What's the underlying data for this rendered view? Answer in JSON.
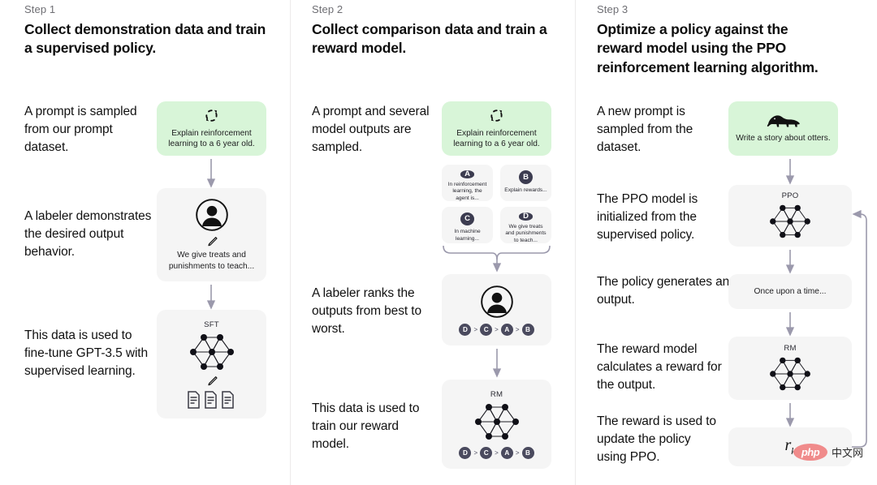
{
  "steps": [
    {
      "label": "Step 1",
      "title": "Collect demonstration data and train a supervised policy.",
      "captions": [
        "A prompt is sampled from our prompt dataset.",
        "A labeler demonstrates the desired output behavior.",
        "This data is used to fine-tune GPT-3.5 with supervised learning."
      ],
      "boxes": {
        "prompt": {
          "text": "Explain reinforcement learning to a 6 year old.",
          "icon": "reinforcement-loop-icon",
          "color": "#d8f5d8"
        },
        "labeler": {
          "text": "We give treats and punishments to teach...",
          "icon": "labeler-person-icon"
        },
        "sft": {
          "title": "SFT",
          "icon": "neural-network-icon"
        }
      }
    },
    {
      "label": "Step 2",
      "title": "Collect comparison data and train a reward model.",
      "captions": [
        "A prompt and several model outputs are sampled.",
        "A labeler ranks the outputs from best to worst.",
        "This data is used to train our reward model."
      ],
      "boxes": {
        "prompt": {
          "text": "Explain reinforcement learning to a 6 year old.",
          "icon": "reinforcement-loop-icon",
          "color": "#d8f5d8"
        },
        "outputs": [
          {
            "badge": "A",
            "text": "In reinforcement learning, the agent is..."
          },
          {
            "badge": "B",
            "text": "Explain rewards..."
          },
          {
            "badge": "C",
            "text": "In machine learning..."
          },
          {
            "badge": "D",
            "text": "We give treats and punishments to teach..."
          }
        ],
        "ranking": [
          "D",
          "C",
          "A",
          "B"
        ],
        "ranking_separator": ">",
        "rm": {
          "title": "RM",
          "icon": "neural-network-icon"
        }
      }
    },
    {
      "label": "Step 3",
      "title": "Optimize a policy against the reward model using the PPO reinforcement learning algorithm.",
      "captions": [
        "A new prompt is sampled from the dataset.",
        "The PPO model is initialized from the supervised policy.",
        "The policy generates an output.",
        "The reward model calculates a reward for the output.",
        "The reward is used to update the policy using PPO."
      ],
      "boxes": {
        "prompt": {
          "text": "Write a story about otters.",
          "icon": "otter-icon",
          "color": "#d8f5d8"
        },
        "ppo": {
          "title": "PPO",
          "icon": "neural-network-icon"
        },
        "output": {
          "text": "Once upon a time..."
        },
        "rm": {
          "title": "RM",
          "icon": "neural-network-icon"
        },
        "reward": {
          "symbol": "r",
          "subscript": "k"
        }
      }
    }
  ],
  "watermark": {
    "logo": "php",
    "text": "中文网"
  },
  "colors": {
    "green_box": "#d8f5d8",
    "gray_box": "#f5f5f5",
    "arrow": "#9b99ac",
    "badge": "#3c3c50",
    "step_label": "#6e6e73"
  }
}
